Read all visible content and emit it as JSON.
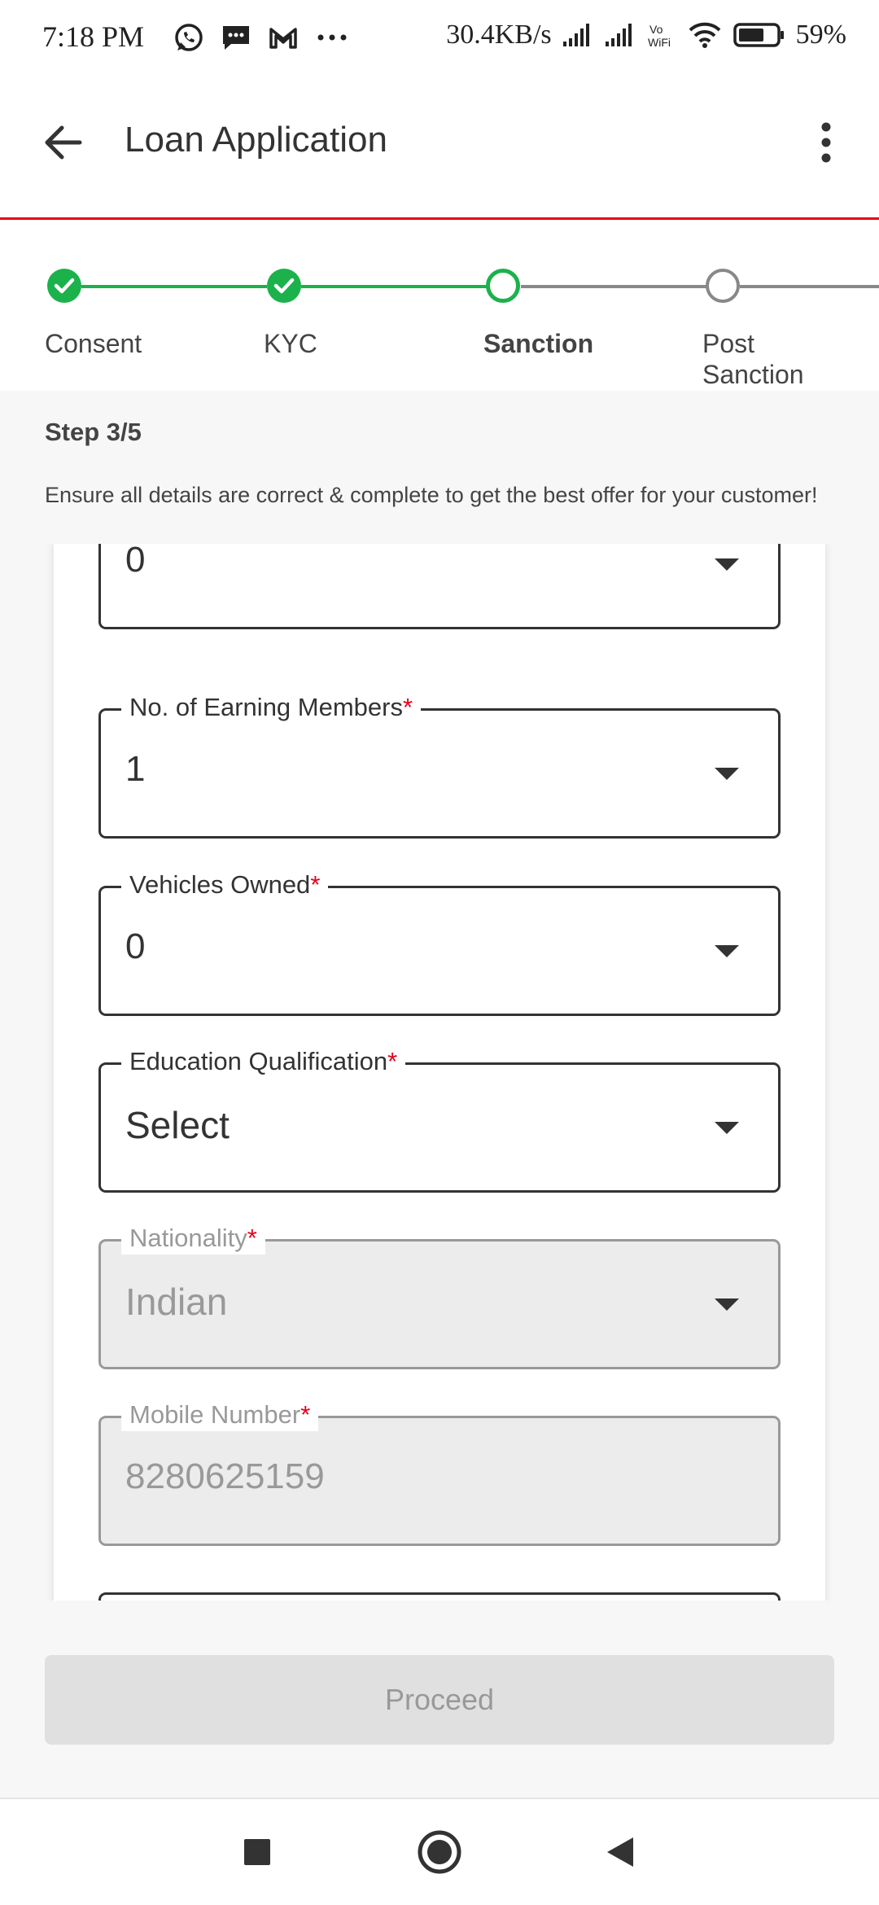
{
  "status_bar": {
    "time": "7:18 PM",
    "speed": "30.4KB/s",
    "battery": "59%",
    "icons": [
      "whatsapp-icon",
      "message-icon",
      "gmail-icon",
      "more-dots-icon",
      "signal-icon",
      "signal-icon",
      "vowifi-icon",
      "wifi-icon",
      "battery-icon"
    ]
  },
  "app_bar": {
    "title": "Loan Application",
    "back_icon": "arrow-left-icon",
    "menu_icon": "more-vert-icon"
  },
  "stepper": {
    "steps": [
      {
        "label": "Consent",
        "state": "done"
      },
      {
        "label": "KYC",
        "state": "done"
      },
      {
        "label": "Sanction",
        "state": "current"
      },
      {
        "label": "Post Sanction",
        "state": "todo"
      }
    ],
    "colors": {
      "done": "#1bb24b",
      "todo": "#888888"
    }
  },
  "info": {
    "step_count": "Step 3/5",
    "hint": "Ensure all details are correct & complete to get the best offer for your customer!"
  },
  "form": {
    "fields": [
      {
        "label": "",
        "value": "0",
        "type": "select",
        "disabled": false
      },
      {
        "label": "No. of Earning Members",
        "value": "1",
        "type": "select",
        "disabled": false,
        "required": true
      },
      {
        "label": "Vehicles Owned",
        "value": "0",
        "type": "select",
        "disabled": false,
        "required": true
      },
      {
        "label": "Education Qualification",
        "value": "Select",
        "type": "select",
        "disabled": false,
        "required": true
      },
      {
        "label": "Nationality",
        "value": "Indian",
        "type": "select",
        "disabled": true,
        "required": true
      },
      {
        "label": "Mobile Number",
        "value": "8280625159",
        "type": "text",
        "disabled": true,
        "required": true
      }
    ]
  },
  "actions": {
    "proceed": "Proceed"
  },
  "nav_bar": {
    "icons": [
      "recents-square-icon",
      "home-circle-icon",
      "back-triangle-icon"
    ]
  },
  "theme": {
    "accent": "#e4001b",
    "success": "#1bb24b"
  }
}
